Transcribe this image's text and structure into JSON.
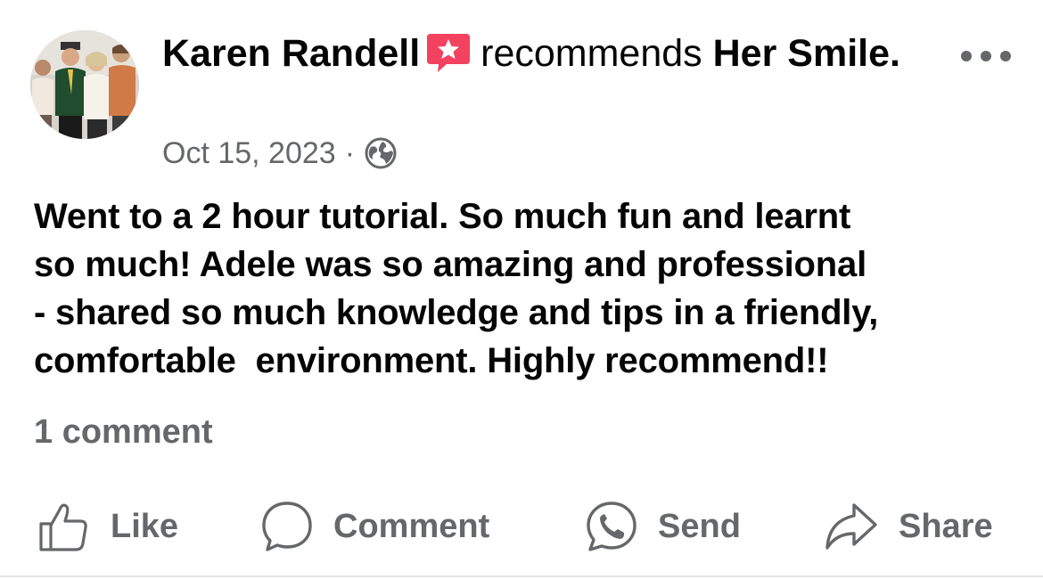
{
  "post": {
    "author": "Karen Randell",
    "verb": "recommends",
    "page_name": "Her Smile.",
    "date": "Oct 15, 2023",
    "separator": "·",
    "privacy_icon": "globe-icon",
    "recommend_icon": "recommend-star-icon",
    "text": "Went to a 2 hour tutorial. So much fun and learnt\nso much! Adele was so amazing and professional\n- shared so much knowledge and tips in a friendly,\ncomfortable  environment. Highly recommend!!",
    "comment_count": "1 comment"
  },
  "actions": {
    "like": {
      "label": "Like",
      "icon": "thumbs-up-icon"
    },
    "comment": {
      "label": "Comment",
      "icon": "comment-bubble-icon"
    },
    "send": {
      "label": "Send",
      "icon": "messenger-send-icon"
    },
    "share": {
      "label": "Share",
      "icon": "share-arrow-icon"
    }
  },
  "colors": {
    "text_primary": "#050505",
    "text_secondary": "#65676b",
    "recommend_badge": "#f3425f",
    "background": "#ffffff"
  }
}
